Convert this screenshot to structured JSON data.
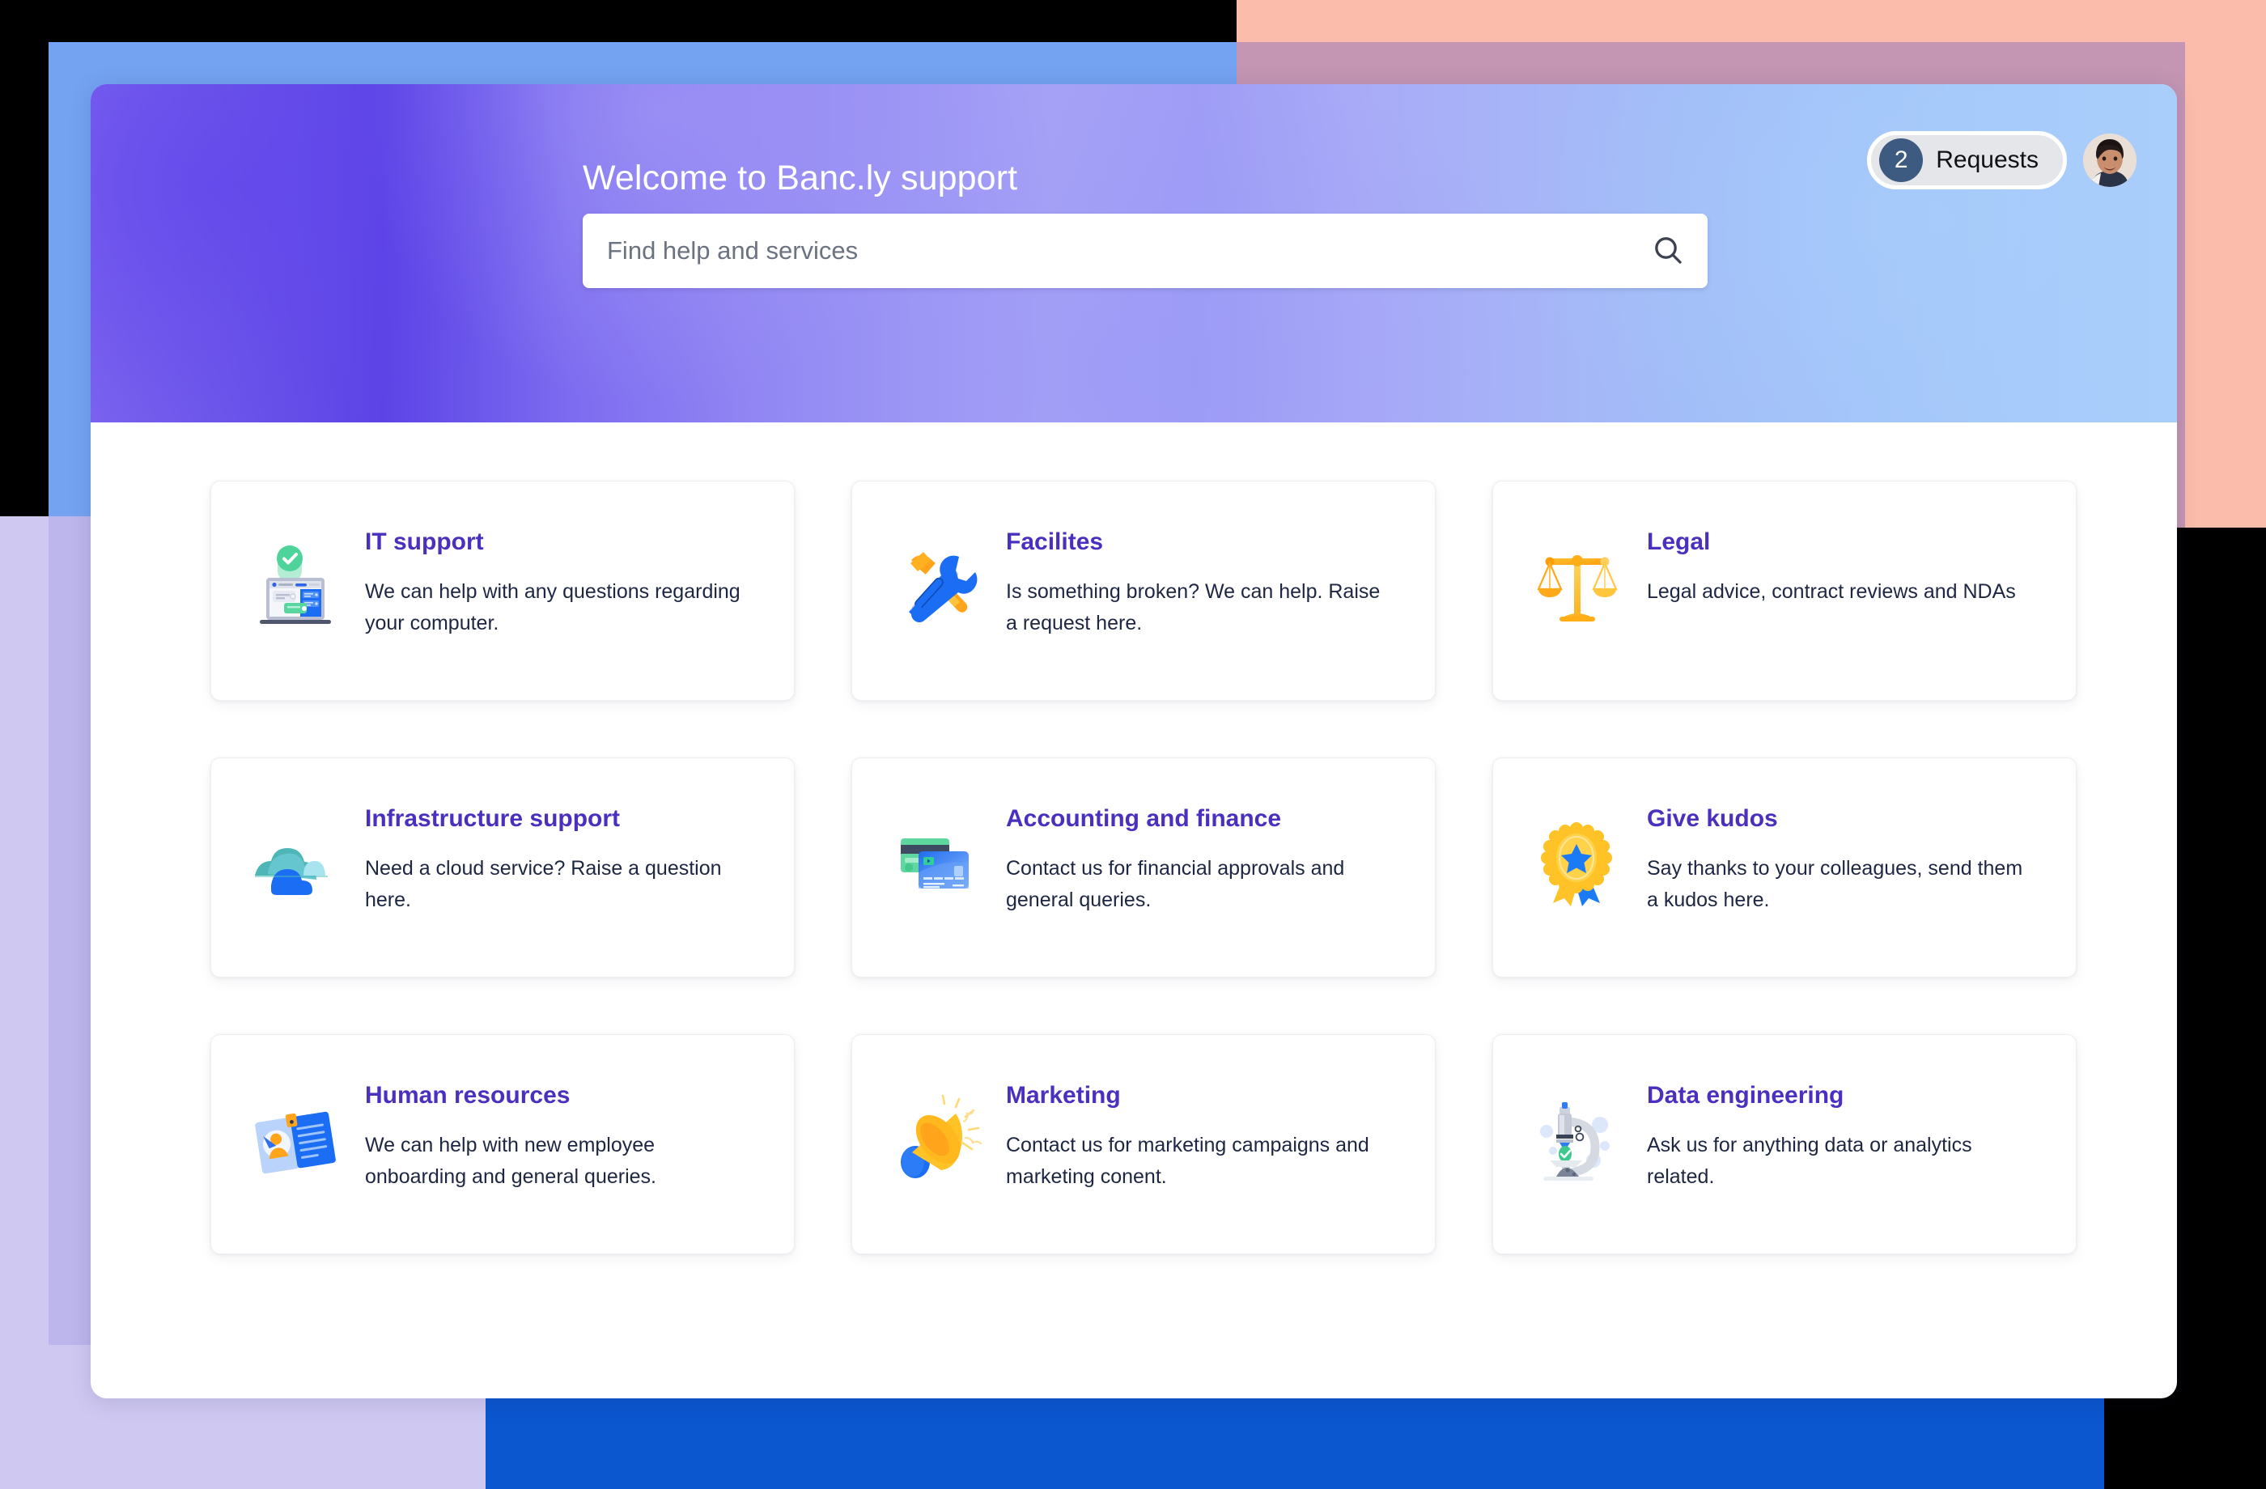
{
  "hero": {
    "title": "Welcome to Banc.ly support",
    "search": {
      "placeholder": "Find help and services",
      "value": "",
      "icon": "search-icon"
    },
    "requests": {
      "count": "2",
      "label": "Requests"
    },
    "avatar": {
      "alt": "User profile photo"
    },
    "colors": {
      "gradient_start": "#6d57ea",
      "gradient_end": "#a9cefb",
      "title_text": "#ffffff",
      "badge_circle": "#3d5a80",
      "pill_background": "#e4e6ea"
    }
  },
  "theme": {
    "card_title": "#4b2fbe",
    "card_desc": "#1d2642",
    "panel_background": "#ffffff",
    "deco_blue_top_left": "#74a3f2",
    "deco_salmon_top_right": "#fcbcab",
    "deco_lavender_bottom_left": "#cfc9f2",
    "deco_blue_bottom_right": "#0b57d0",
    "page_background": "#000000"
  },
  "cards": [
    {
      "id": "it-support",
      "title": "IT support",
      "desc": "We can help with any questions regarding your computer.",
      "icon": "laptop-check-icon"
    },
    {
      "id": "facilities",
      "title": "Facilites",
      "desc": "Is something broken? We can help. Raise a request here.",
      "icon": "hammer-wrench-icon"
    },
    {
      "id": "legal",
      "title": "Legal",
      "desc": "Legal advice, contract reviews and NDAs",
      "icon": "balance-scales-icon"
    },
    {
      "id": "infrastructure-support",
      "title": "Infrastructure support",
      "desc": "Need a cloud service? Raise a question here.",
      "icon": "cloud-icon"
    },
    {
      "id": "accounting-and-finance",
      "title": "Accounting and finance",
      "desc": "Contact us for financial approvals and general queries.",
      "icon": "credit-cards-icon"
    },
    {
      "id": "give-kudos",
      "title": "Give kudos",
      "desc": "Say thanks to your colleagues, send them a kudos here.",
      "icon": "award-rosette-icon"
    },
    {
      "id": "human-resources",
      "title": "Human resources",
      "desc": "We can help with new employee onboarding and general queries.",
      "icon": "id-badge-clipboard-icon"
    },
    {
      "id": "marketing",
      "title": "Marketing",
      "desc": "Contact us for marketing campaigns and marketing conent.",
      "icon": "megaphone-icon"
    },
    {
      "id": "data-engineering",
      "title": "Data engineering",
      "desc": "Ask us for anything data or analytics related.",
      "icon": "microscope-icon"
    }
  ]
}
